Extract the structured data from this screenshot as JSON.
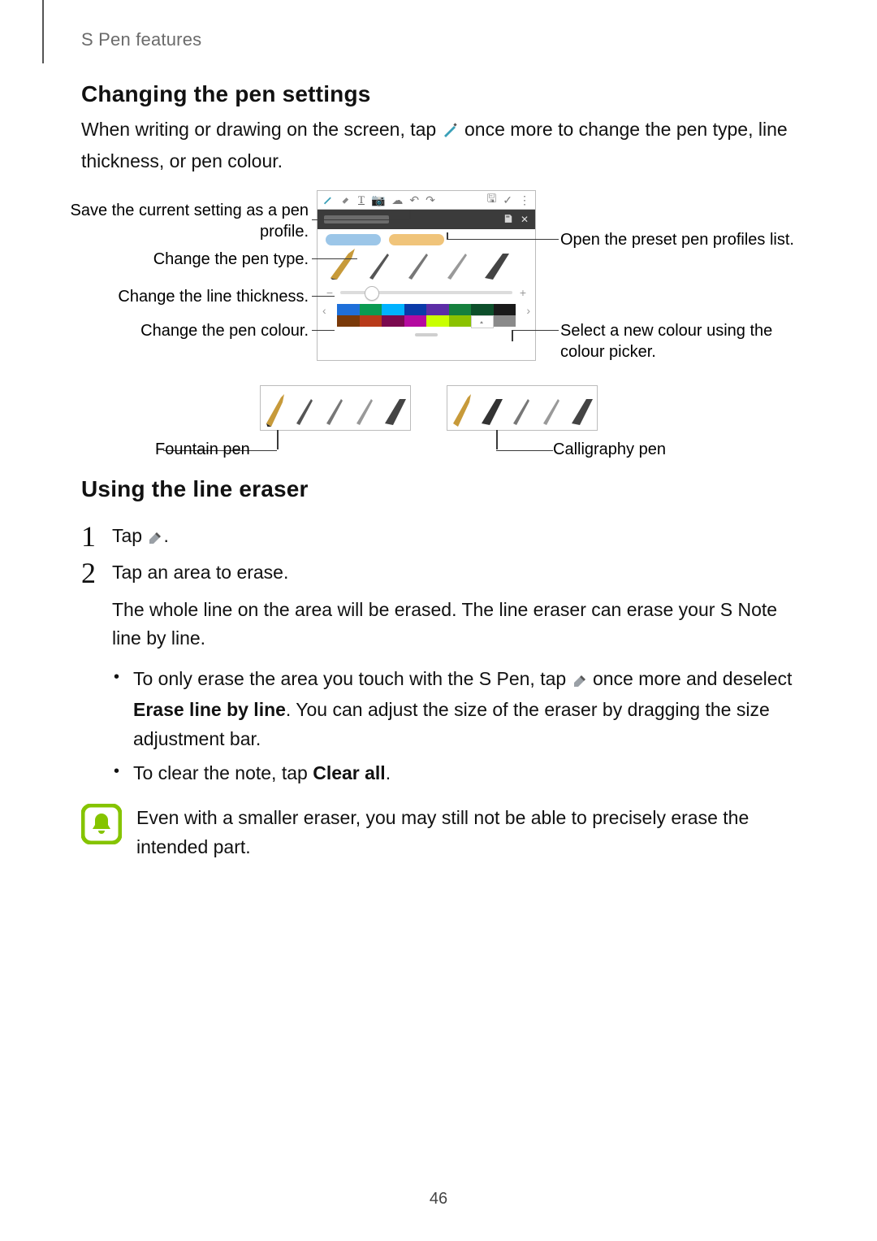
{
  "breadcrumb": "S Pen features",
  "section1_title": "Changing the pen settings",
  "section1_lead_a": "When writing or drawing on the screen, tap ",
  "section1_lead_b": " once more to change the pen type, line thickness, or pen colour.",
  "callouts": {
    "save_profile": "Save the current setting as a pen profile.",
    "change_type": "Change the pen type.",
    "change_thickness": "Change the line thickness.",
    "change_colour": "Change the pen colour.",
    "open_presets": "Open the preset pen profiles list.",
    "colour_picker": "Select a new colour using the colour picker.",
    "fountain": "Fountain pen",
    "calligraphy": "Calligraphy pen"
  },
  "palette": [
    "#1e6fd9",
    "#0a9b52",
    "#00b2ff",
    "#0a3aa8",
    "#5c2da6",
    "#15803d",
    "#0d4f2b",
    "#1a1a1a",
    "#7a3a0a",
    "#b83a1a",
    "#7b0a4f",
    "#b50aa0",
    "#c9ff00",
    "#8bc200",
    "#ffffff",
    "#8a8a8a"
  ],
  "section2_title": "Using the line eraser",
  "steps": {
    "s1_a": "Tap ",
    "s1_b": ".",
    "s2_a": "Tap an area to erase.",
    "s2_b": "The whole line on the area will be erased. The line eraser can erase your S Note line by line.",
    "b1_a": "To only erase the area you touch with the S Pen, tap ",
    "b1_b": " once more and deselect ",
    "b1_bold": "Erase line by line",
    "b1_c": ". You can adjust the size of the eraser by dragging the size adjustment bar.",
    "b2_a": "To clear the note, tap ",
    "b2_bold": "Clear all",
    "b2_b": "."
  },
  "note_text": "Even with a smaller eraser, you may still not be able to precisely erase the intended part.",
  "page_number": "46"
}
